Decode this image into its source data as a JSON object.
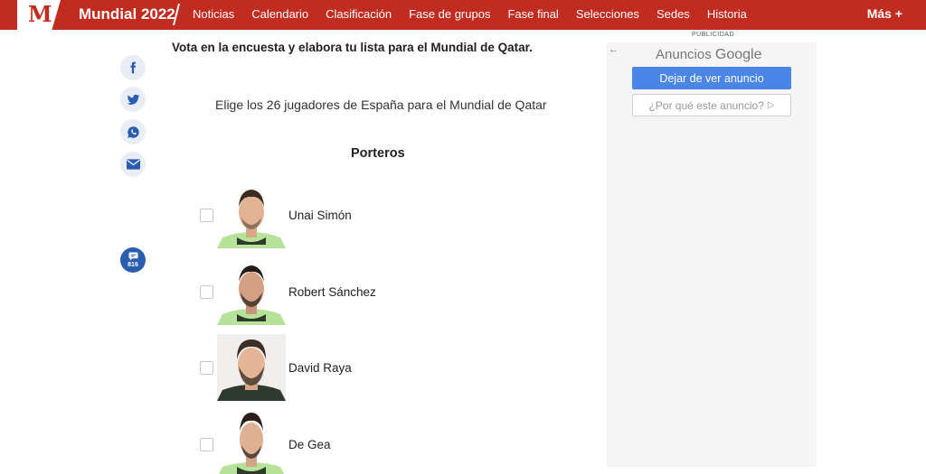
{
  "header": {
    "logo_letter": "M",
    "brand": "Mundial 2022",
    "nav": [
      "Noticias",
      "Calendario",
      "Clasificación",
      "Fase de grupos",
      "Fase final",
      "Selecciones",
      "Sedes",
      "Historia"
    ],
    "more_label": "Más +"
  },
  "share": {
    "icons": [
      "facebook-icon",
      "twitter-icon",
      "whatsapp-icon",
      "mail-icon"
    ],
    "comments_count": "816"
  },
  "article": {
    "intro": "Vota en la encuesta y elabora tu lista para el Mundial de Qatar.",
    "subtitle": "Elige los 26 jugadores de España para el Mundial de Qatar",
    "section": "Porteros",
    "players": [
      {
        "name": "Unai Simón",
        "checked": false
      },
      {
        "name": "Robert Sánchez",
        "checked": false
      },
      {
        "name": "David Raya",
        "checked": false
      },
      {
        "name": "De Gea",
        "checked": false
      }
    ]
  },
  "ad": {
    "label": "PUBLICIDAD",
    "title_prefix": "Anuncios",
    "title_brand": "Google",
    "stop_button": "Dejar de ver anuncio",
    "why_button": "¿Por qué este anuncio?",
    "back_glyph": "←",
    "why_glyph": "▷"
  },
  "colors": {
    "brand_red": "#c22b1f",
    "share_blue": "#2a5db0",
    "ad_button_blue": "#4a86e8"
  }
}
